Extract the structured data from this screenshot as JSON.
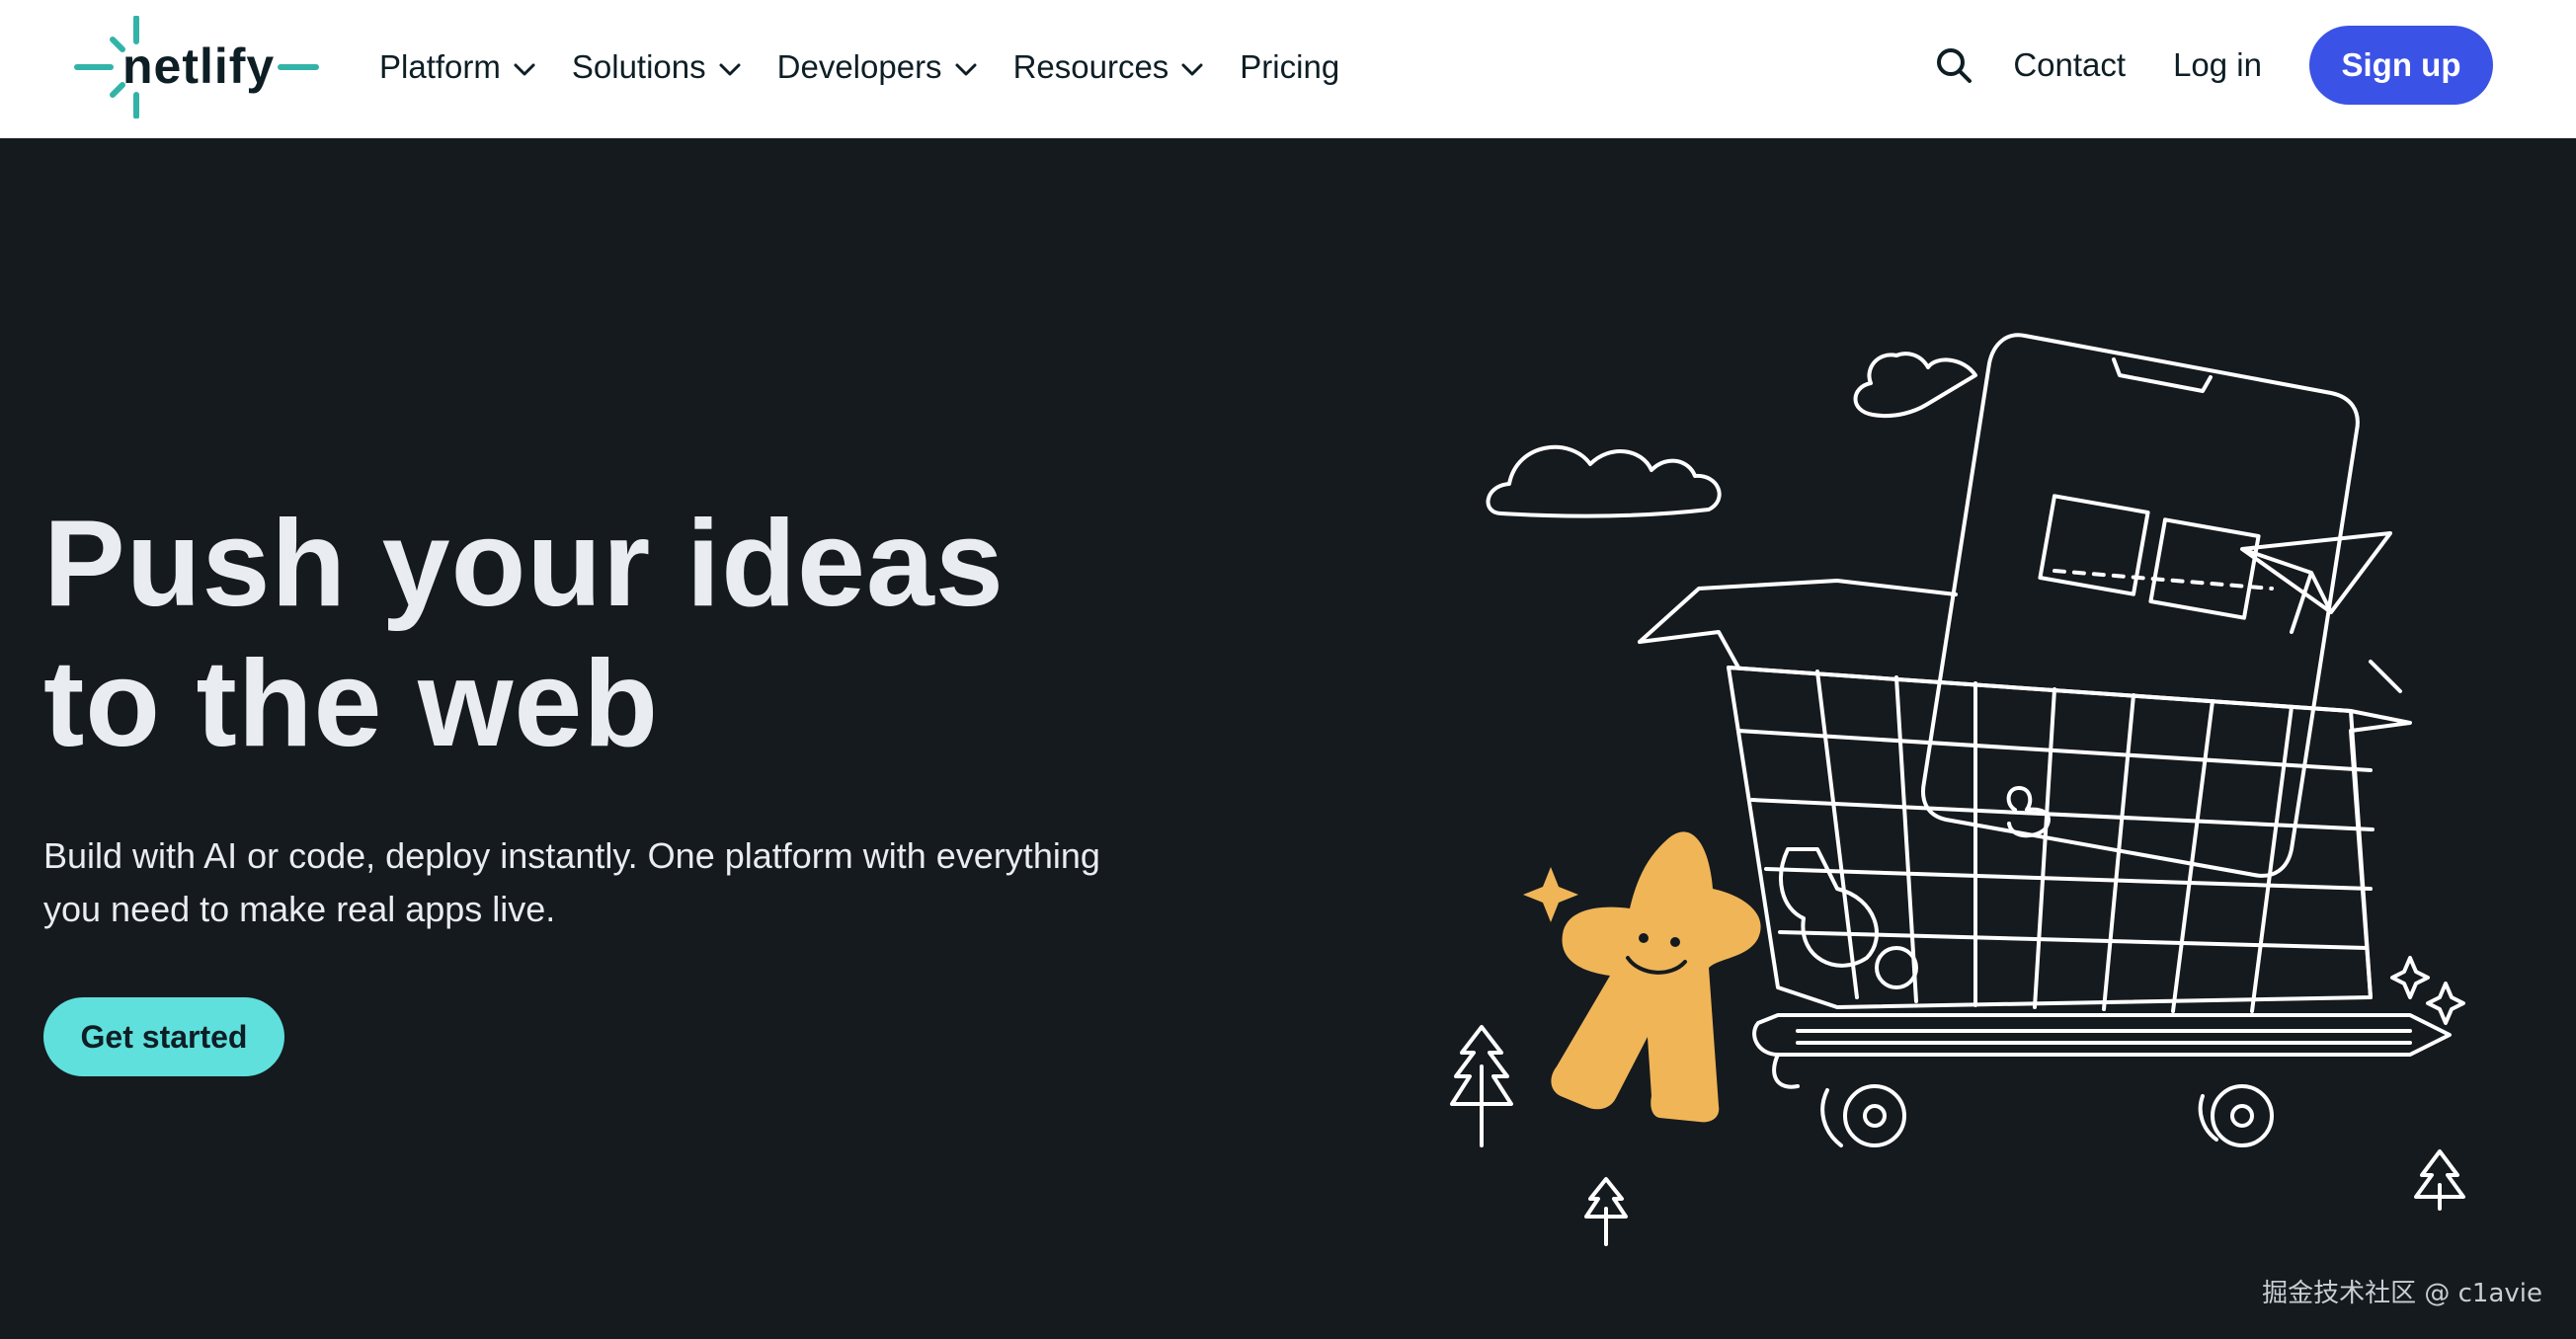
{
  "header": {
    "logo_text": "netlify",
    "nav": [
      {
        "label": "Platform",
        "has_dropdown": true
      },
      {
        "label": "Solutions",
        "has_dropdown": true
      },
      {
        "label": "Developers",
        "has_dropdown": true
      },
      {
        "label": "Resources",
        "has_dropdown": true
      },
      {
        "label": "Pricing",
        "has_dropdown": false
      }
    ],
    "search_icon": "search-icon",
    "contact_label": "Contact",
    "login_label": "Log in",
    "signup_label": "Sign up"
  },
  "hero": {
    "title_line1": "Push your ideas",
    "title_line2": "to the web",
    "subtitle_line1": "Build with AI or code, deploy instantly. One platform with everything",
    "subtitle_line2": "you need to make real apps live.",
    "cta_label": "Get started"
  },
  "watermark": "掘金技术社区 @ c1avie",
  "colors": {
    "header_bg": "#ffffff",
    "hero_bg": "#151a1f",
    "brand_teal": "#32b3a8",
    "signup_blue": "#3b52e6",
    "cta_teal": "#5fe0dc",
    "mascot_orange": "#f0b557"
  }
}
